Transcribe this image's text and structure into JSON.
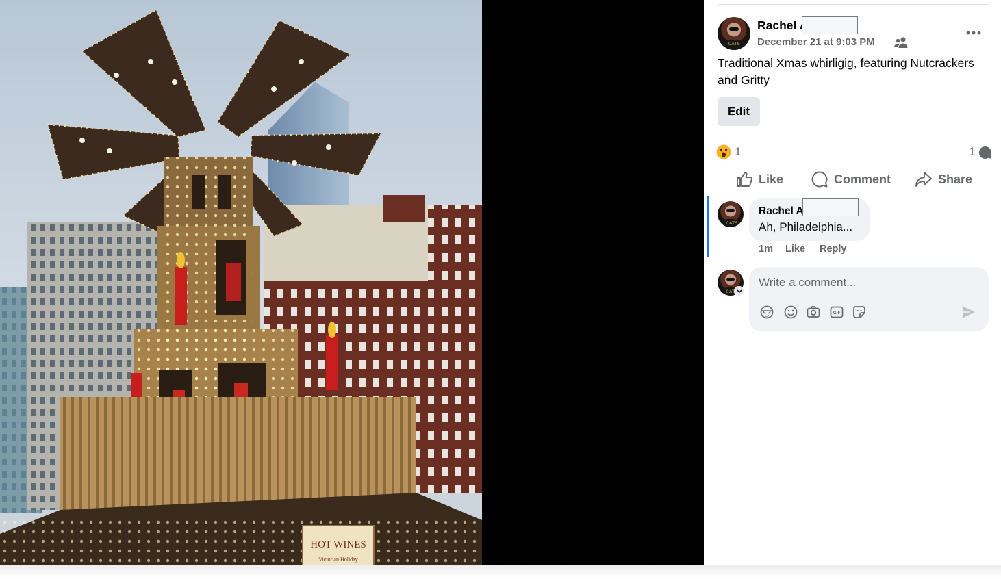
{
  "post": {
    "author": "Rachel A",
    "date": "December 21 at 9:03 PM",
    "audience_icon": "friends-icon",
    "text": "Traditional Xmas whirligig, featuring Nutcrackers and Gritty",
    "edit_label": "Edit",
    "photo_signs": {
      "hot_wines": "HOT WINES",
      "subtitle": "Victorian Holiday"
    }
  },
  "stats": {
    "reaction_icon": "wow-reaction-icon",
    "reaction_count": "1",
    "comment_count": "1"
  },
  "actions": {
    "like": "Like",
    "comment": "Comment",
    "share": "Share"
  },
  "comment": {
    "author": "Rachel A",
    "text": "Ah, Philadelphia...",
    "time": "1m",
    "like": "Like",
    "reply": "Reply"
  },
  "composer": {
    "placeholder": "Write a comment...",
    "tools": [
      "avatar-sticker-icon",
      "emoji-icon",
      "camera-icon",
      "gif-icon",
      "sticker-icon"
    ],
    "send_icon": "send-icon",
    "gif_text": "GIF"
  },
  "colors": {
    "accent": "#1877f2",
    "secondary_text": "#65676b",
    "bubble": "#f0f2f5",
    "button": "#e4e6eb"
  }
}
